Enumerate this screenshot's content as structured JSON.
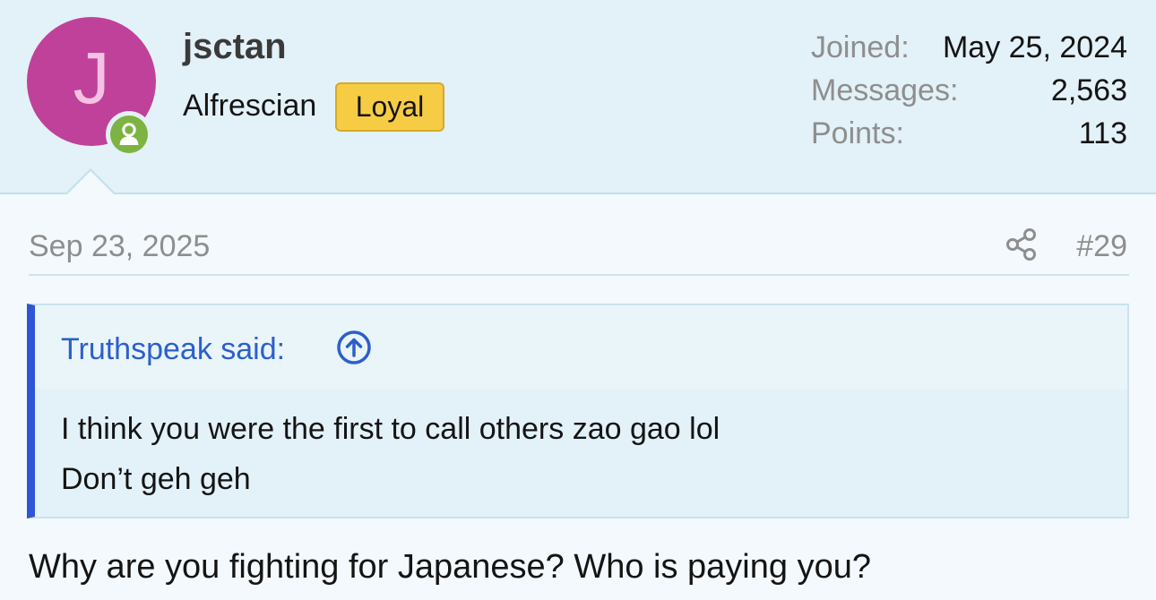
{
  "user": {
    "avatar_letter": "J",
    "username": "jsctan",
    "title": "Alfrescian",
    "badge": "Loyal",
    "online_icon": "person-icon"
  },
  "stats": [
    {
      "label": "Joined:",
      "value": "May 25, 2024"
    },
    {
      "label": "Messages:",
      "value": "2,563"
    },
    {
      "label": "Points:",
      "value": "113"
    }
  ],
  "post": {
    "date": "Sep 23, 2025",
    "share_icon": "share-icon",
    "number": "#29",
    "quote": {
      "attribution": "Truthspeak said:",
      "lines": [
        "I think you were the first to call others zao gao lol",
        "Don’t geh geh"
      ]
    },
    "body": "Why are you fighting for Japanese? Who is paying you?"
  },
  "colors": {
    "avatar_bg": "#c0419a",
    "avatar_letter": "#f4c2e2",
    "online": "#7cb342",
    "badge": "#f7cc45",
    "quote_accent": "#2f55d4",
    "link": "#2c5fcc"
  }
}
